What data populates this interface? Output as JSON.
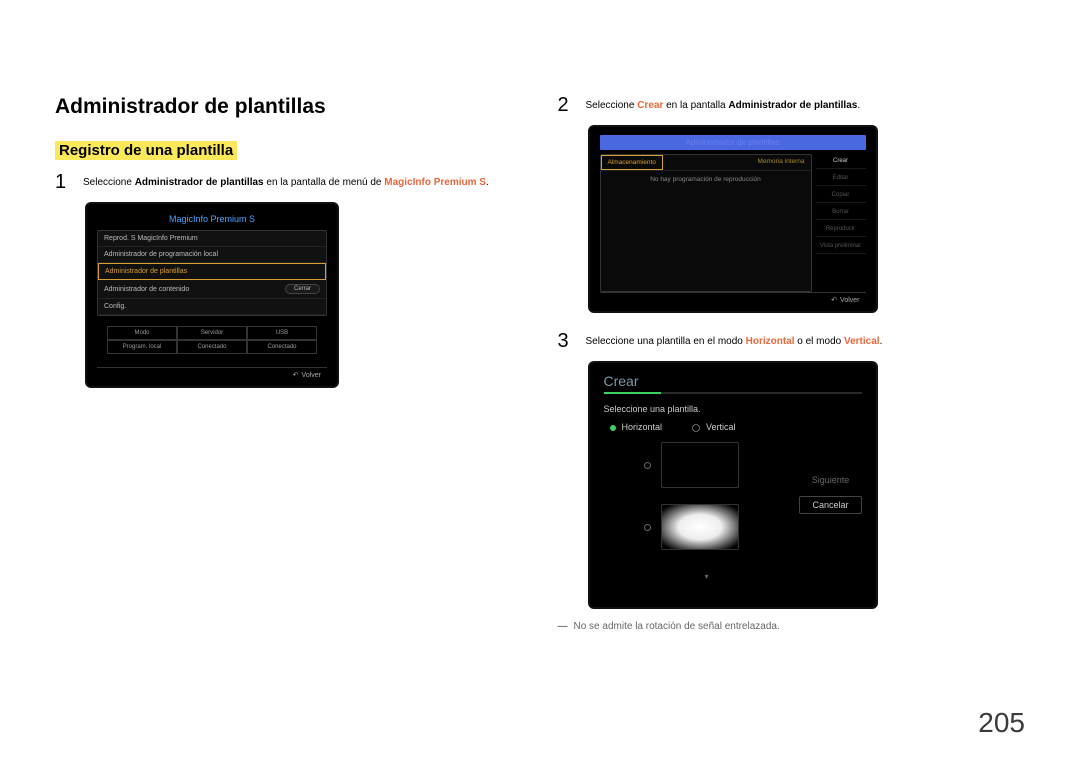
{
  "heading": "Administrador de plantillas",
  "subheading": "Registro de una plantilla",
  "page_number": "205",
  "steps": {
    "s1": {
      "num": "1",
      "pre": "Seleccione ",
      "hl1": "Administrador de plantillas",
      "mid": " en la pantalla de menú de ",
      "hl2": "MagicInfo Premium S",
      "post": "."
    },
    "s2": {
      "num": "2",
      "pre": "Seleccione ",
      "hl1": "Crear",
      "mid": " en la pantalla ",
      "hl2": "Administrador de plantillas",
      "post": "."
    },
    "s3": {
      "num": "3",
      "pre": "Seleccione una plantilla en el modo ",
      "hl1": "Horizontal",
      "mid": " o el modo ",
      "hl2": "Vertical",
      "post": "."
    }
  },
  "note": "No se admite la rotación de señal entrelazada.",
  "mock1": {
    "title": "MagicInfo Premium S",
    "items": [
      "Reprod. S MagicInfo Premium",
      "Administrador de programación local",
      "Administrador de plantillas",
      "Administrador de contenido",
      "Config."
    ],
    "cerrar": "Cerrar",
    "table": [
      "Modo",
      "Servidor",
      "USB",
      "Program. local",
      "Conectado",
      "Conectado"
    ],
    "volver": "Volver"
  },
  "mock2": {
    "titlebar": "Administrador de plantillas",
    "tab_sel": "Almacenamiento",
    "tab_other": "Memoria interna",
    "msg": "No hay programación de reproducción",
    "side": [
      "Crear",
      "Editar",
      "Copiar",
      "Borrar",
      "Reproducir",
      "Vista preliminar"
    ],
    "volver": "Volver"
  },
  "mock3": {
    "header": "Crear",
    "sub": "Seleccione una plantilla.",
    "opt1": "Horizontal",
    "opt2": "Vertical",
    "siguiente": "Siguiente",
    "cancelar": "Cancelar"
  }
}
